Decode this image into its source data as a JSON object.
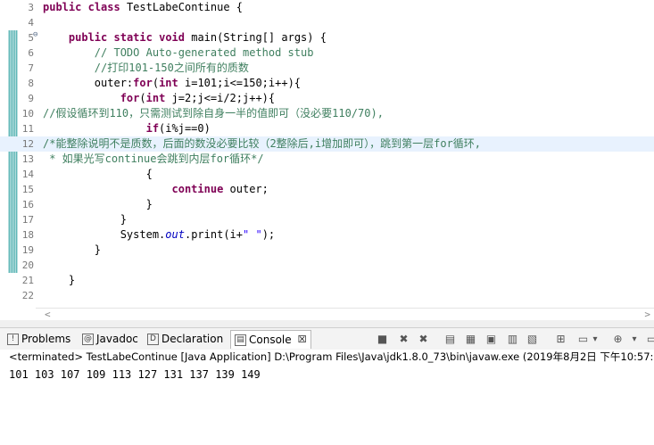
{
  "editor": {
    "lines": [
      {
        "no": "3",
        "segs": [
          {
            "c": "kw",
            "t": "public"
          },
          {
            "t": " "
          },
          {
            "c": "kw",
            "t": "class"
          },
          {
            "t": " TestLabeContinue {"
          }
        ]
      },
      {
        "no": "4",
        "segs": []
      },
      {
        "no": "5",
        "fold": "⊖",
        "segs": [
          {
            "t": "    "
          },
          {
            "c": "kw",
            "t": "public"
          },
          {
            "t": " "
          },
          {
            "c": "kw",
            "t": "static"
          },
          {
            "t": " "
          },
          {
            "c": "kw",
            "t": "void"
          },
          {
            "t": " main(String[] args) {"
          }
        ]
      },
      {
        "no": "6",
        "segs": [
          {
            "t": "        "
          },
          {
            "c": "cm",
            "t": "// TODO Auto-generated method stub"
          }
        ]
      },
      {
        "no": "7",
        "segs": [
          {
            "t": "        "
          },
          {
            "c": "cm",
            "t": "//打印101-150之间所有的质数"
          }
        ]
      },
      {
        "no": "8",
        "segs": [
          {
            "t": "        outer:"
          },
          {
            "c": "kw",
            "t": "for"
          },
          {
            "t": "("
          },
          {
            "c": "kw",
            "t": "int"
          },
          {
            "t": " i=101;i<=150;i++){"
          }
        ]
      },
      {
        "no": "9",
        "segs": [
          {
            "t": "            "
          },
          {
            "c": "kw",
            "t": "for"
          },
          {
            "t": "("
          },
          {
            "c": "kw",
            "t": "int"
          },
          {
            "t": " j=2;j<=i/2;j++){"
          }
        ]
      },
      {
        "no": "10",
        "segs": [
          {
            "c": "cm",
            "t": "//假设循环到110，只需测试到除自身一半的值即可（没必要110/70),"
          }
        ]
      },
      {
        "no": "11",
        "segs": [
          {
            "t": "                "
          },
          {
            "c": "kw",
            "t": "if"
          },
          {
            "t": "(i%j==0)"
          }
        ]
      },
      {
        "no": "12",
        "hl": true,
        "segs": [
          {
            "c": "cm",
            "t": "/*能整除说明不是质数，后面的数没必要比较（2整除后,i增加即可），跳到第一层for循环,"
          }
        ]
      },
      {
        "no": "13",
        "segs": [
          {
            "c": "cm",
            "t": " * 如果光写continue会跳到内层for循环*/"
          }
        ]
      },
      {
        "no": "14",
        "segs": [
          {
            "t": "                {"
          }
        ]
      },
      {
        "no": "15",
        "segs": [
          {
            "t": "                    "
          },
          {
            "c": "kw",
            "t": "continue"
          },
          {
            "t": " outer;"
          }
        ]
      },
      {
        "no": "16",
        "segs": [
          {
            "t": "                }"
          }
        ]
      },
      {
        "no": "17",
        "segs": [
          {
            "t": "            }"
          }
        ]
      },
      {
        "no": "18",
        "segs": [
          {
            "t": "            System."
          },
          {
            "c": "fd",
            "t": "out"
          },
          {
            "t": ".print(i+"
          },
          {
            "c": "st",
            "t": "\" \""
          },
          {
            "t": ");"
          }
        ]
      },
      {
        "no": "19",
        "segs": [
          {
            "t": "        }"
          }
        ]
      },
      {
        "no": "20",
        "segs": []
      },
      {
        "no": "21",
        "segs": [
          {
            "t": "    }"
          }
        ]
      },
      {
        "no": "22",
        "segs": []
      }
    ]
  },
  "tabs": [
    {
      "name": "tab-problems",
      "label": "Problems",
      "icon": "problems-icon",
      "glyph": "!"
    },
    {
      "name": "tab-javadoc",
      "label": "Javadoc",
      "icon": "at-icon",
      "glyph": "@"
    },
    {
      "name": "tab-declaration",
      "label": "Declaration",
      "icon": "declaration-icon",
      "glyph": "D"
    },
    {
      "name": "tab-console",
      "label": "Console",
      "icon": "console-icon",
      "glyph": "▤",
      "active": true
    }
  ],
  "console_close": "☒",
  "toolbar": [
    {
      "name": "terminate-icon",
      "glyph": "■"
    },
    {
      "name": "remove-launch-icon",
      "glyph": "✖"
    },
    {
      "name": "remove-all-terminated-icon",
      "glyph": "✖"
    },
    {
      "name": "clear-console-icon",
      "glyph": "▤"
    },
    {
      "name": "scroll-lock-icon",
      "glyph": "▦"
    },
    {
      "name": "word-wrap-icon",
      "glyph": "▣"
    },
    {
      "name": "show-on-stdout-icon",
      "glyph": "▥"
    },
    {
      "name": "show-on-stderr-icon",
      "glyph": "▧"
    },
    {
      "name": "pin-console-icon",
      "glyph": "⊞"
    },
    {
      "name": "display-console-icon",
      "glyph": "▭"
    },
    {
      "name": "display-console-dropdown-icon",
      "glyph": "▾"
    },
    {
      "name": "open-console-icon",
      "glyph": "⊕"
    },
    {
      "name": "open-console-dropdown-icon",
      "glyph": "▾"
    },
    {
      "name": "minimize-icon",
      "glyph": "▭"
    }
  ],
  "console": {
    "status": "<terminated> TestLabeContinue [Java Application] D:\\Program Files\\Java\\jdk1.8.0_73\\bin\\javaw.exe (2019年8月2日 下午10:57:",
    "output": "101 103 107 109 113 127 131 137 139 149"
  },
  "scroll": {
    "left": "<",
    "right": ">"
  }
}
